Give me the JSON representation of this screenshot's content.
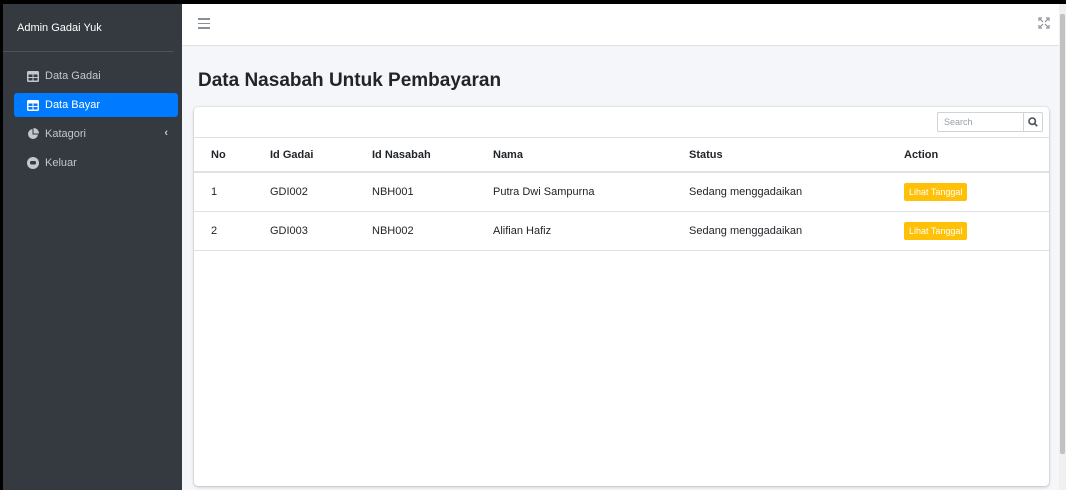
{
  "sidebar": {
    "brand": "Admin Gadai Yuk",
    "items": [
      {
        "label": "Data Gadai",
        "icon": "table-icon"
      },
      {
        "label": "Data Bayar",
        "icon": "table-icon",
        "active": true
      },
      {
        "label": "Katagori",
        "icon": "chart-pie-icon",
        "has_submenu": true
      },
      {
        "label": "Keluar",
        "icon": "user-astronaut-icon"
      }
    ]
  },
  "topbar": {
    "menu_icon": "hamburger-icon",
    "fullscreen_icon": "expand-icon"
  },
  "main": {
    "title": "Data Nasabah Untuk Pembayaran",
    "search": {
      "placeholder": "Search",
      "value": ""
    },
    "table": {
      "headers": [
        "No",
        "Id Gadai",
        "Id Nasabah",
        "Nama",
        "Status",
        "Action"
      ],
      "rows": [
        {
          "no": "1",
          "id_gadai": "GDI002",
          "id_nasabah": "NBH001",
          "nama": "Putra Dwi Sampurna",
          "status": "Sedang menggadaikan",
          "action": "Lihat Tanggal"
        },
        {
          "no": "2",
          "id_gadai": "GDI003",
          "id_nasabah": "NBH002",
          "nama": "Alifian Hafiz",
          "status": "Sedang menggadaikan",
          "action": "Lihat Tanggal"
        }
      ]
    }
  },
  "colors": {
    "sidebar_bg": "#343a40",
    "active": "#007bff",
    "warning": "#ffc107"
  }
}
